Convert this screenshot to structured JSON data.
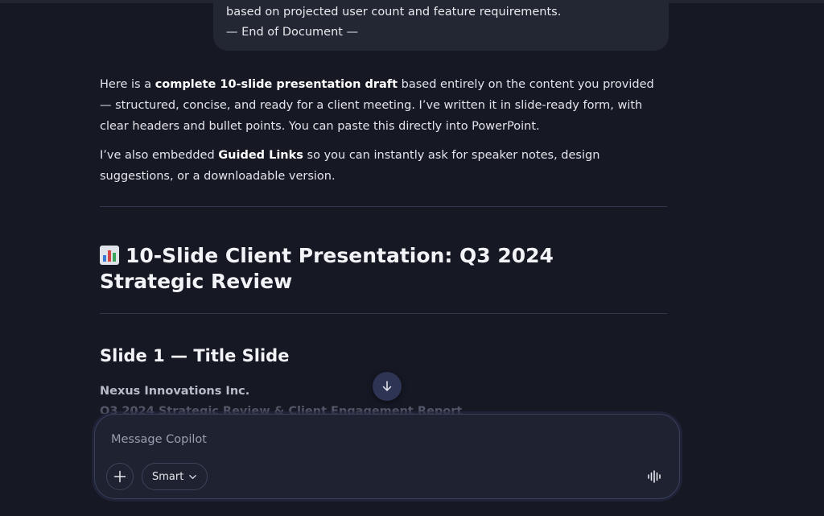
{
  "user_message": {
    "line1": "based on projected user count and feature requirements.",
    "line2": "— End of Document —"
  },
  "response": {
    "intro_part1": "Here is a ",
    "intro_bold": "complete 10-slide presentation draft",
    "intro_part2": " based entirely on the content you provided — structured, concise, and ready for a client meeting. I’ve written it in slide-ready form, with clear headers and bullet points. You can paste this directly into PowerPoint.",
    "links_part1": "I’ve also embedded ",
    "links_bold": "Guided Links",
    "links_part2": " so you can instantly ask for speaker notes, design suggestions, or a downloadable version.",
    "heading_emoji": "bar-chart-emoji",
    "heading": "10-Slide Client Presentation: Q3 2024 Strategic Review",
    "slide1_heading": "Slide 1 — Title Slide",
    "company": "Nexus Innovations Inc.",
    "subtitle": "Q3 2024 Strategic Review & Client Engagement Report"
  },
  "composer": {
    "placeholder": "Message Copilot",
    "mode_label": "Smart"
  },
  "icons": {
    "scroll": "arrow-down-icon",
    "add": "plus-icon",
    "mode": "chevron-down-icon",
    "voice": "voice-waveform-icon"
  },
  "colors": {
    "background": "#161824",
    "bubble": "#232633",
    "composer": "#1f2231",
    "scroll_button": "#2e3454"
  }
}
